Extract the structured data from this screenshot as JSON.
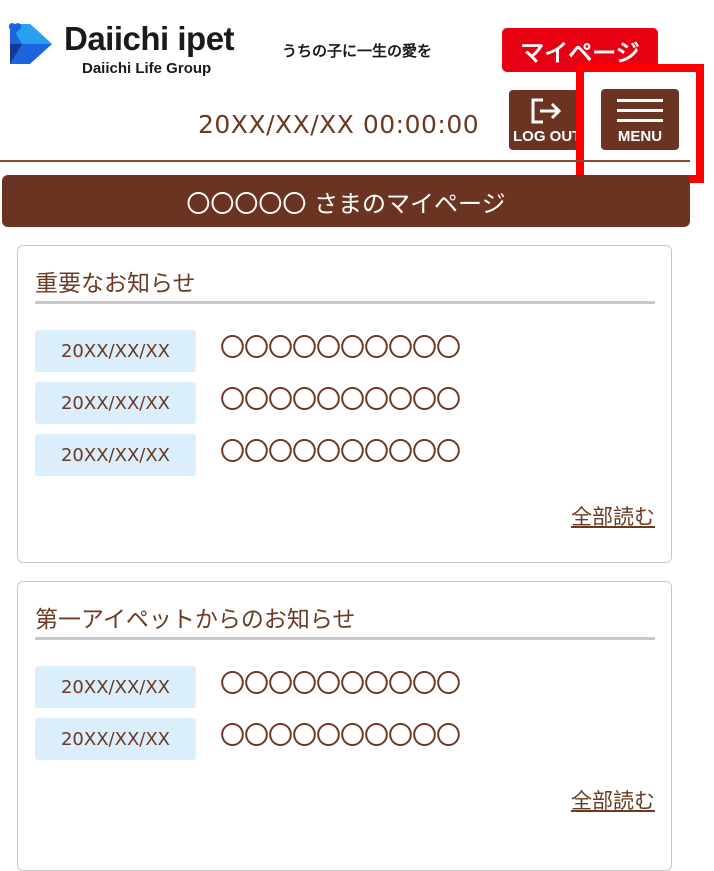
{
  "brand": {
    "name": "Daiichi ipet",
    "subname": "Daiichi Life Group",
    "tagline": "うちの子に一生の愛を",
    "colors": {
      "primary": "#6b3422",
      "accent": "#e60012",
      "logo_blue": "#1e64dc"
    }
  },
  "header": {
    "mypage_label": "マイページ",
    "datetime": "20XX/XX/XX 00:00:00",
    "logout_label": "LOG OUT",
    "logout_icon": "logout-arrow-icon",
    "menu_label": "MENU",
    "menu_icon": "hamburger-icon"
  },
  "page_title": "〇〇〇〇〇 さまのマイページ",
  "important_notices": {
    "title": "重要なお知らせ",
    "items": [
      {
        "date": "20XX/XX/XX",
        "title": "〇〇〇〇〇〇〇〇〇〇"
      },
      {
        "date": "20XX/XX/XX",
        "title": "〇〇〇〇〇〇〇〇〇〇"
      },
      {
        "date": "20XX/XX/XX",
        "title": "〇〇〇〇〇〇〇〇〇〇"
      }
    ],
    "read_all": "全部読む"
  },
  "company_notices": {
    "title": "第一アイペットからのお知らせ",
    "items": [
      {
        "date": "20XX/XX/XX",
        "title": "〇〇〇〇〇〇〇〇〇〇"
      },
      {
        "date": "20XX/XX/XX",
        "title": "〇〇〇〇〇〇〇〇〇〇"
      }
    ],
    "read_all": "全部読む"
  }
}
